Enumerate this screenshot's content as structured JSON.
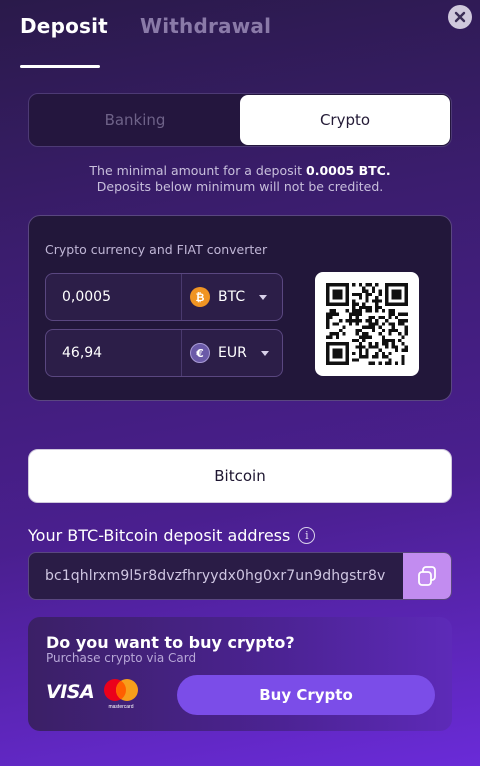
{
  "tabs": [
    {
      "label": "Deposit",
      "active": true
    },
    {
      "label": "Withdrawal",
      "active": false
    }
  ],
  "segment": {
    "banking": "Banking",
    "crypto": "Crypto",
    "selected": "Crypto"
  },
  "notice": {
    "line1_prefix": "The minimal amount for a deposit ",
    "line1_amount": "0.0005 BTC.",
    "line2": "Deposits below minimum will not be credited."
  },
  "converter": {
    "title": "Crypto currency and FIAT converter",
    "crypto_value": "0,0005",
    "crypto_currency": "BTC",
    "fiat_value": "46,94",
    "fiat_currency": "EUR"
  },
  "coin_select": {
    "label": "Bitcoin"
  },
  "address": {
    "label": "Your BTC-Bitcoin deposit address",
    "value": "bc1qhlrxm9l5r8dvzfhryydx0hg0xr7un9dhgstr8v"
  },
  "buy": {
    "title": "Do you want to buy crypto?",
    "subtitle": "Purchase crypto via Card",
    "visa": "VISA",
    "mastercard": "mastercard",
    "button": "Buy Crypto"
  },
  "colors": {
    "accent": "#7b4de8",
    "copy": "#c28cf0",
    "btc": "#f09423"
  },
  "icons": [
    "close-icon",
    "btc-coin-icon",
    "eur-coin-icon",
    "chevron-down-icon",
    "info-icon",
    "copy-icon",
    "qr-code",
    "visa-logo",
    "mastercard-logo"
  ]
}
